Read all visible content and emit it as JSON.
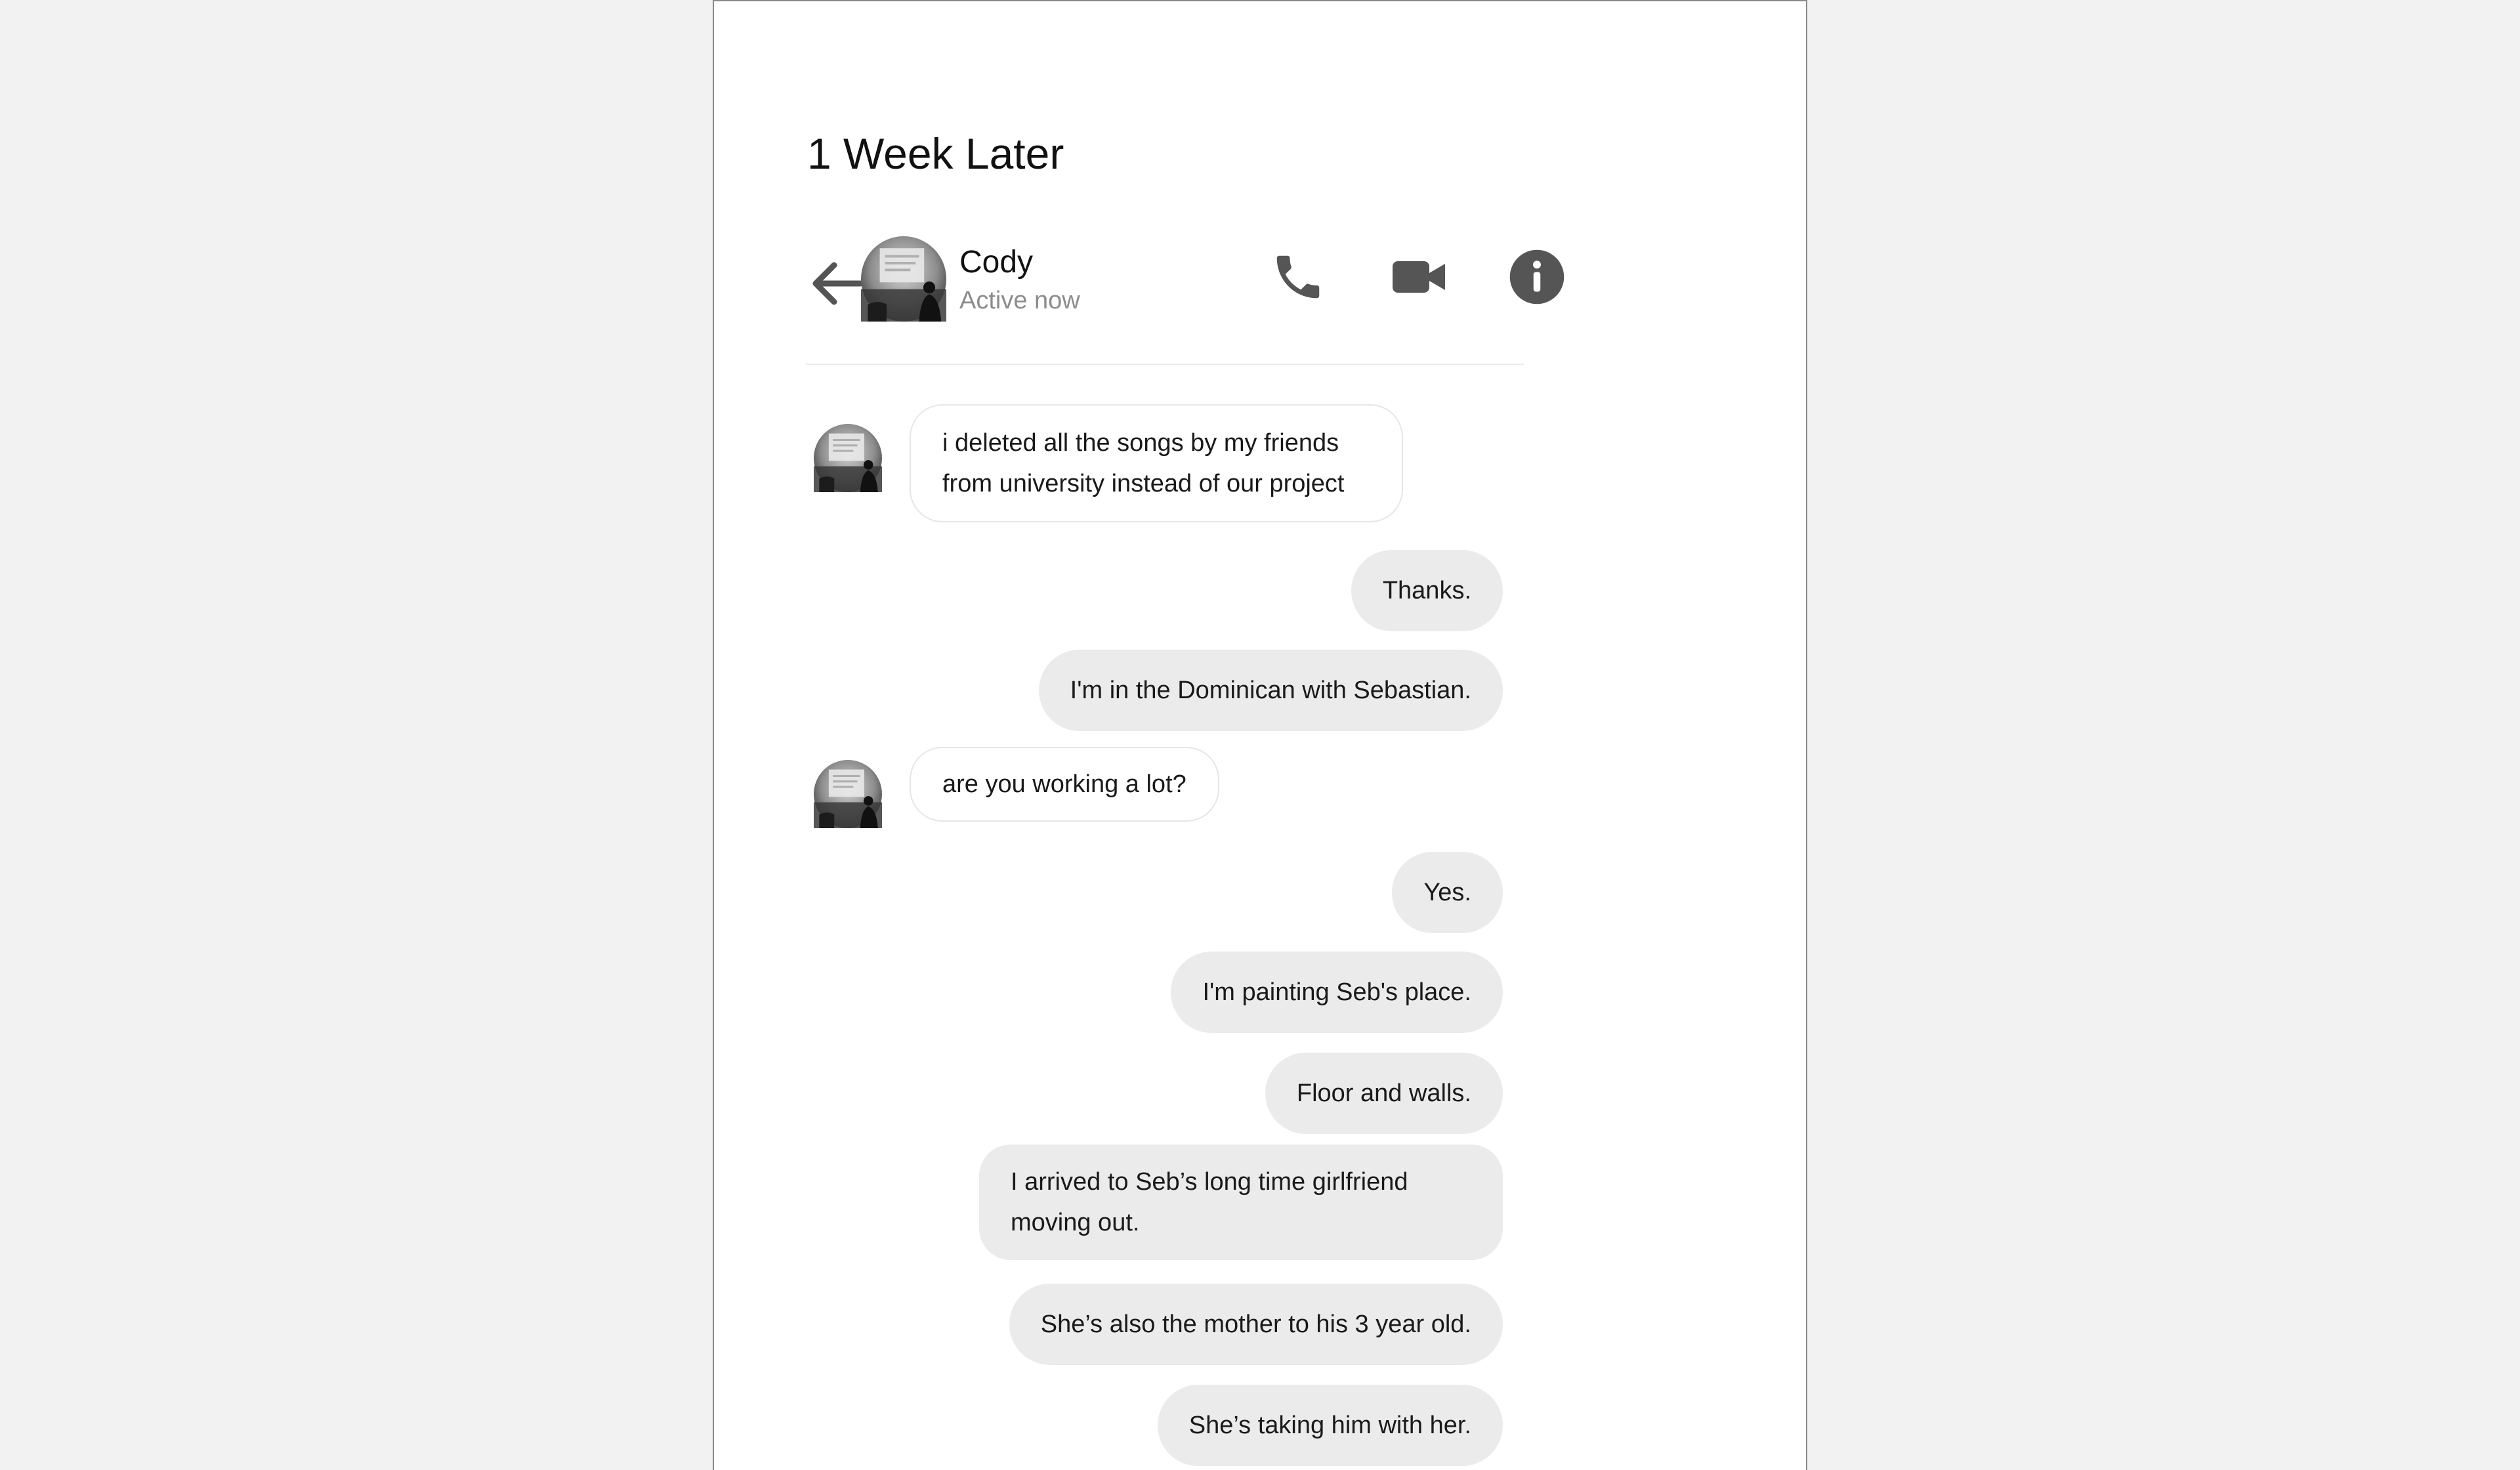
{
  "page_title": "1 Week Later",
  "header": {
    "contact_name": "Cody",
    "status": "Active now",
    "icons": {
      "back": "arrow-left-icon",
      "call": "phone-icon",
      "video": "video-camera-icon",
      "info": "info-icon"
    }
  },
  "colors": {
    "icon": "#555555",
    "incoming_bubble_bg": "#ffffff",
    "incoming_bubble_border": "#e6e6e6",
    "outgoing_bubble_bg": "#eaebea",
    "status_text": "#8c8c8c"
  },
  "messages": [
    {
      "from": "Cody",
      "text": "i deleted all the songs by my friends from university instead of our project"
    },
    {
      "from": "me",
      "text": "Thanks."
    },
    {
      "from": "me",
      "text": "I'm in the Dominican with Sebastian."
    },
    {
      "from": "Cody",
      "text": "are you working a lot?"
    },
    {
      "from": "me",
      "text": "Yes."
    },
    {
      "from": "me",
      "text": "I'm painting Seb's place."
    },
    {
      "from": "me",
      "text": "Floor and walls."
    },
    {
      "from": "me",
      "text": "I arrived to Seb’s long time girlfriend moving out."
    },
    {
      "from": "me",
      "text": "She’s also the mother to his 3 year old."
    },
    {
      "from": "me",
      "text": "She’s taking him with her."
    }
  ]
}
